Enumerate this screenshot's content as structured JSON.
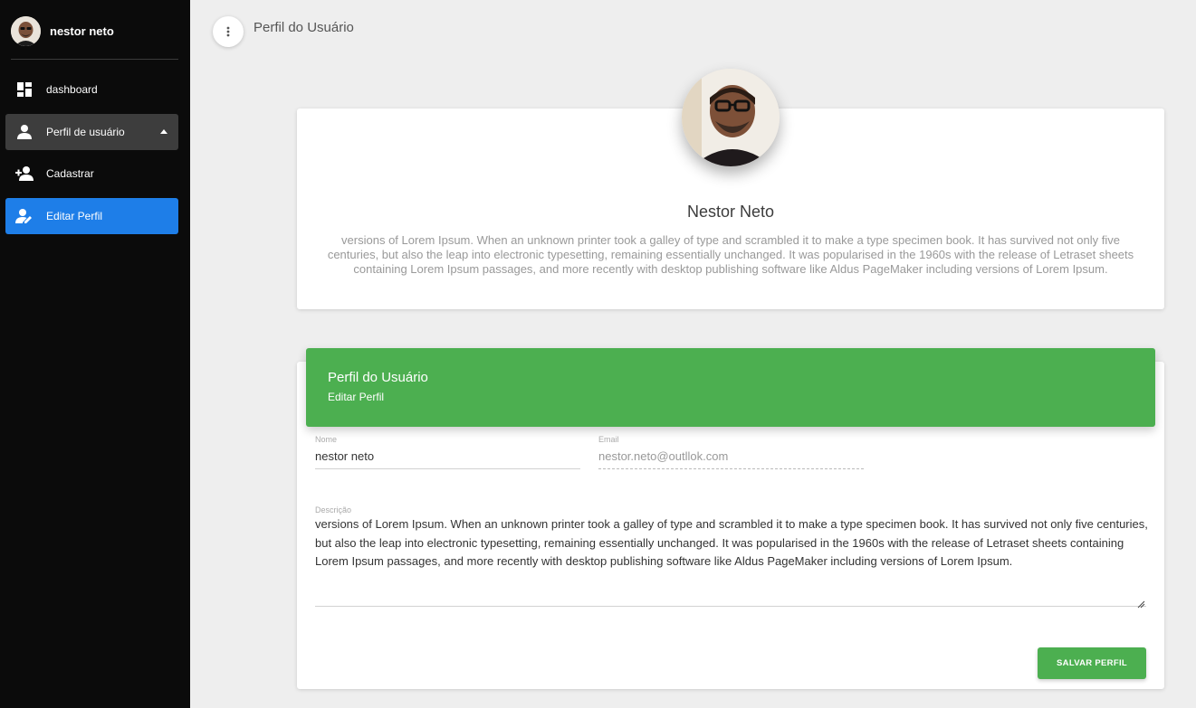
{
  "sidebar": {
    "user_name": "nestor neto",
    "items": [
      {
        "label": "dashboard",
        "icon": "dashboard-icon"
      },
      {
        "label": "Perfil de usuário",
        "icon": "person-icon"
      },
      {
        "label": "Cadastrar",
        "icon": "person-add-icon"
      },
      {
        "label": "Editar Perfil",
        "icon": "person-edit-icon"
      }
    ]
  },
  "topbar": {
    "title": "Perfil do Usuário"
  },
  "profile": {
    "name": "Nestor Neto",
    "description": "versions of Lorem Ipsum. When an unknown printer took a galley of type and scrambled it to make a type specimen book. It has survived not only five centuries, but also the leap into electronic typesetting, remaining essentially unchanged. It was popularised in the 1960s with the release of Letraset sheets containing Lorem Ipsum passages, and more recently with desktop publishing software like Aldus PageMaker including versions of Lorem Ipsum."
  },
  "form": {
    "title": "Perfil do Usuário",
    "subtitle": "Editar Perfil",
    "name_label": "Nome",
    "name_value": "nestor neto",
    "email_label": "Email",
    "email_value": "nestor.neto@outllok.com",
    "description_label": "Descrição",
    "description_value": "versions of Lorem Ipsum. When an unknown printer took a galley of type and scrambled it to make a type specimen book. It has survived not only five centuries, but also the leap into electronic typesetting, remaining essentially unchanged. It was popularised in the 1960s with the release of Letraset sheets containing Lorem Ipsum passages, and more recently with desktop publishing software like Aldus PageMaker including versions of Lorem Ipsum.",
    "save_label": "SALVAR PERFIL"
  },
  "colors": {
    "sidebar_bg": "#0b0b0b",
    "active_item": "#1e7ee8",
    "expanded_item": "#3d3d3d",
    "accent_green": "#4caf50",
    "page_bg": "#eeeeee"
  }
}
